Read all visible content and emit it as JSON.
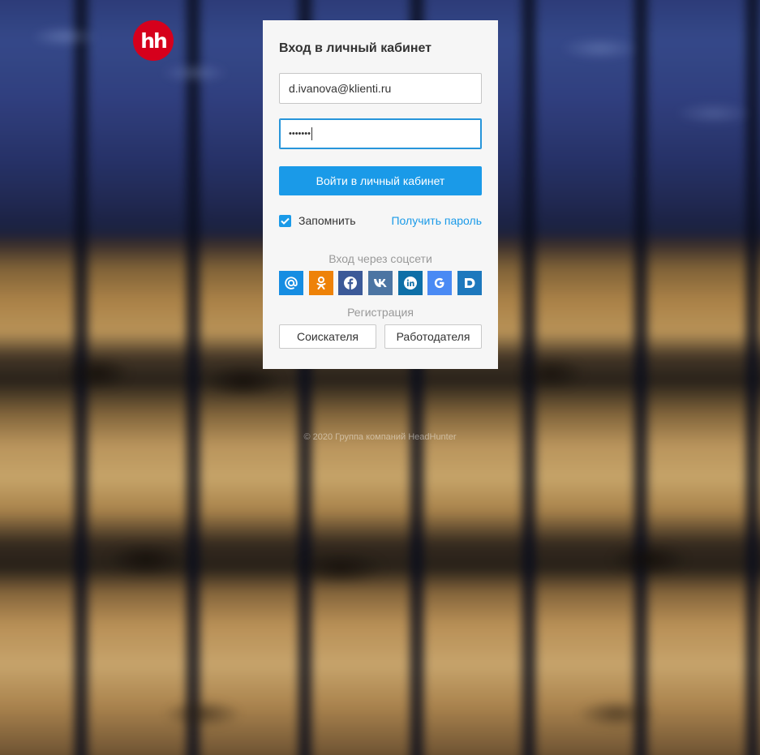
{
  "brand": {
    "logo_text": "hh",
    "logo_color": "#d6001c"
  },
  "login_form": {
    "title": "Вход в личный кабинет",
    "email_value": "d.ivanova@klienti.ru",
    "password_value": "•••••••",
    "submit_label": "Войти в личный кабинет",
    "remember_label": "Запомнить",
    "remember_checked": true,
    "forgot_password_label": "Получить пароль",
    "accent_color": "#1a9ae8"
  },
  "social_login": {
    "caption": "Вход через соцсети",
    "providers": [
      {
        "name": "mail-ru",
        "icon": "at-sign-icon",
        "color": "#168de2"
      },
      {
        "name": "odnoklassniki",
        "icon": "ok-icon",
        "color": "#ee8208"
      },
      {
        "name": "facebook",
        "icon": "facebook-icon",
        "color": "#3b5998"
      },
      {
        "name": "vkontakte",
        "icon": "vk-icon",
        "color": "#4c75a3"
      },
      {
        "name": "linkedin",
        "icon": "linkedin-icon",
        "color": "#0e6fa7"
      },
      {
        "name": "google",
        "icon": "google-icon",
        "color": "#4a8af4"
      },
      {
        "name": "dnevnik",
        "icon": "d-icon",
        "color": "#1d78bd"
      }
    ]
  },
  "registration": {
    "caption": "Регистрация",
    "seeker_label": "Соискателя",
    "employer_label": "Работодателя"
  },
  "footer": {
    "copyright": "© 2020 Группа компаний HeadHunter"
  }
}
